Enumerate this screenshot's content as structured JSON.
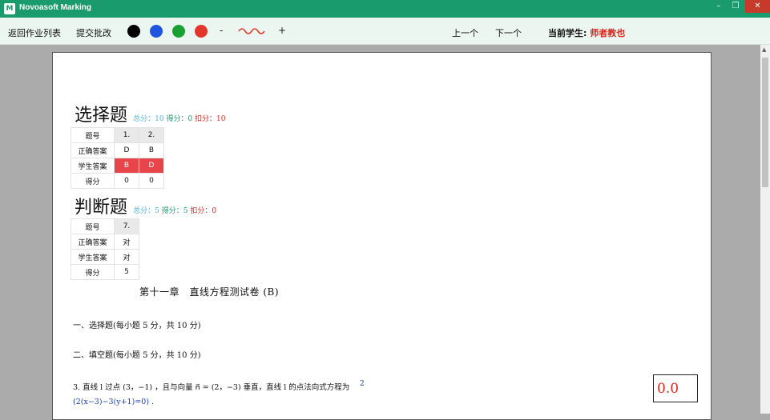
{
  "window": {
    "title": "Novoasoft Marking",
    "icon_letter": "M"
  },
  "toolbar": {
    "back_label": "返回作业列表",
    "submit_label": "提交批改",
    "pen_colors": [
      "#000000",
      "#1f56e0",
      "#19a032",
      "#e2362a"
    ],
    "pen_minus": "-",
    "pen_plus": "+",
    "prev_label": "上一个",
    "next_label": "下一个",
    "student_label": "当前学生:",
    "student_name": "师者教也"
  },
  "choice": {
    "title": "选择题",
    "total": "总分：10",
    "got": "得分：0",
    "deduct": "扣分：10",
    "rows": {
      "qno_label": "题号",
      "correct_label": "正确答案",
      "student_label": "学生答案",
      "score_label": "得分"
    },
    "questions": [
      "1.",
      "2."
    ],
    "correct": [
      "D",
      "B"
    ],
    "student": [
      "B",
      "D"
    ],
    "scores": [
      "0",
      "0"
    ]
  },
  "judge": {
    "title": "判断题",
    "total": "总分：5",
    "got": "得分：5",
    "deduct": "扣分：0",
    "rows": {
      "qno_label": "题号",
      "correct_label": "正确答案",
      "student_label": "学生答案",
      "score_label": "得分"
    },
    "questions": [
      "7."
    ],
    "correct": [
      "对"
    ],
    "student": [
      "对"
    ],
    "scores": [
      "5"
    ]
  },
  "doc": {
    "title": "第十一章　直线方程测试卷 (B)",
    "section1": "一、选择题(每小题 5 分，共 10 分)",
    "section2": "二、填空题(每小题 5 分，共 10 分)",
    "q3": "3. 直线 l 过点 (3，−1) ，且与向量 n⃗ = (2，−3) 垂直，直线 l 的点法向式方程为",
    "q3_answer": "(2(x−3)−3(y+1)=0) .",
    "q3_mark": "2",
    "score_box": "0.0"
  }
}
